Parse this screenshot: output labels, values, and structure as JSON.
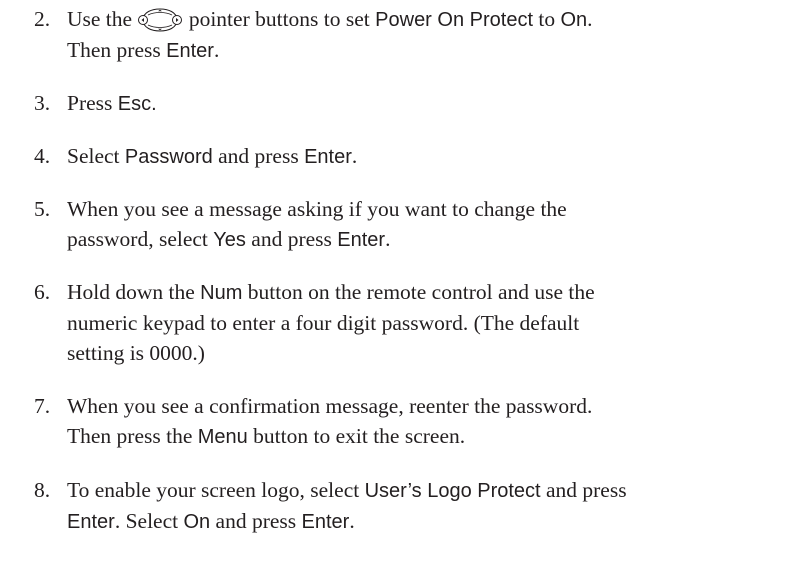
{
  "steps": [
    {
      "number": "2.",
      "lines": [
        [
          {
            "t": "Use the ",
            "ui": false
          },
          {
            "icon": "pointer-buttons-icon"
          },
          {
            "t": " pointer buttons to set ",
            "ui": false
          },
          {
            "t": "Power On Protect",
            "ui": true
          },
          {
            "t": " to ",
            "ui": false
          },
          {
            "t": "On",
            "ui": true
          },
          {
            "t": ".",
            "ui": false
          }
        ],
        [
          {
            "t": "Then press ",
            "ui": false
          },
          {
            "t": "Enter",
            "ui": true
          },
          {
            "t": ".",
            "ui": false
          }
        ]
      ]
    },
    {
      "number": "3.",
      "lines": [
        [
          {
            "t": "Press ",
            "ui": false
          },
          {
            "t": "Esc.",
            "ui": true
          }
        ]
      ]
    },
    {
      "number": "4.",
      "lines": [
        [
          {
            "t": "Select ",
            "ui": false
          },
          {
            "t": "Password",
            "ui": true
          },
          {
            "t": " and press ",
            "ui": false
          },
          {
            "t": "Enter",
            "ui": true
          },
          {
            "t": ".",
            "ui": false
          }
        ]
      ]
    },
    {
      "number": "5.",
      "lines": [
        [
          {
            "t": "When you see a message asking if you want to change the",
            "ui": false
          }
        ],
        [
          {
            "t": "password, select ",
            "ui": false
          },
          {
            "t": "Yes",
            "ui": true
          },
          {
            "t": " and press ",
            "ui": false
          },
          {
            "t": "Enter",
            "ui": true
          },
          {
            "t": ".",
            "ui": false
          }
        ]
      ]
    },
    {
      "number": "6.",
      "lines": [
        [
          {
            "t": "Hold down the ",
            "ui": false
          },
          {
            "t": "Num",
            "ui": true
          },
          {
            "t": " button on the remote control and use the",
            "ui": false
          }
        ],
        [
          {
            "t": "numeric keypad to enter a four digit password. (The default",
            "ui": false
          }
        ],
        [
          {
            "t": "setting is 0000.)",
            "ui": false
          }
        ]
      ]
    },
    {
      "number": "7.",
      "lines": [
        [
          {
            "t": "When you see a confirmation message, reenter the password.",
            "ui": false
          }
        ],
        [
          {
            "t": "Then press the ",
            "ui": false
          },
          {
            "t": "Menu",
            "ui": true
          },
          {
            "t": " button to exit the screen.",
            "ui": false
          }
        ]
      ]
    },
    {
      "number": "8.",
      "lines": [
        [
          {
            "t": "To enable your screen logo, select ",
            "ui": false
          },
          {
            "t": "User’s Logo Protect",
            "ui": true
          },
          {
            "t": " and press",
            "ui": false
          }
        ],
        [
          {
            "t": "Enter",
            "ui": true
          },
          {
            "t": ". Select ",
            "ui": false
          },
          {
            "t": "On",
            "ui": true
          },
          {
            "t": " and press ",
            "ui": false
          },
          {
            "t": "Enter",
            "ui": true
          },
          {
            "t": ".",
            "ui": false
          }
        ]
      ]
    }
  ]
}
